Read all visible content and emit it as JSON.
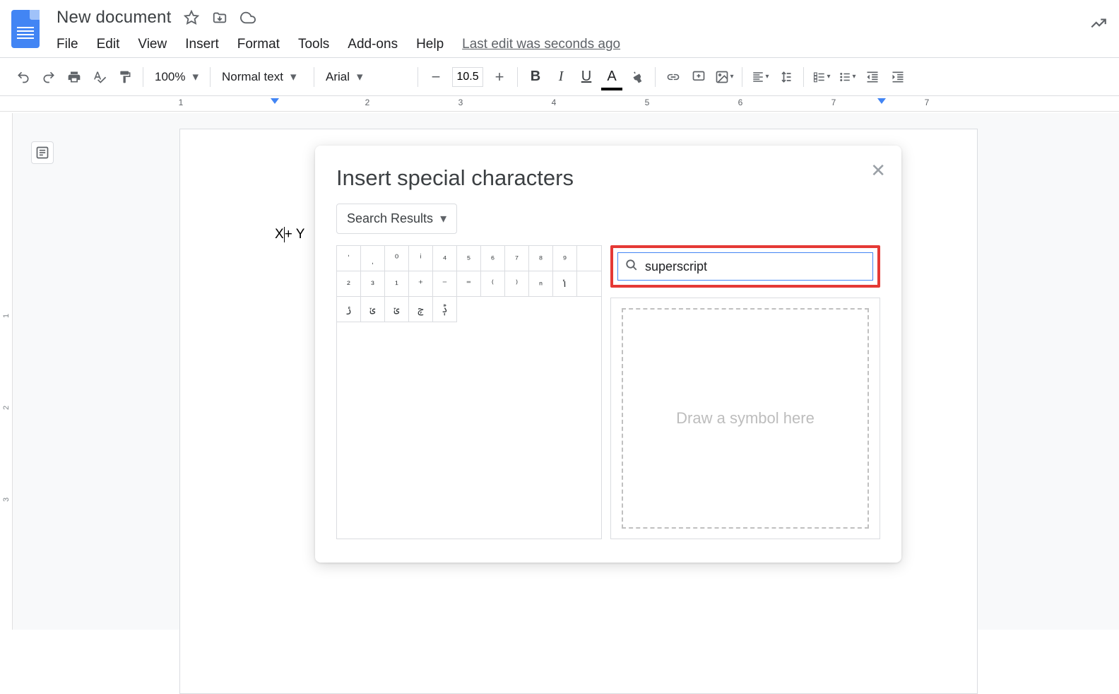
{
  "doc_title": "New document",
  "menu": [
    "File",
    "Edit",
    "View",
    "Insert",
    "Format",
    "Tools",
    "Add-ons",
    "Help"
  ],
  "last_edit": "Last edit was seconds ago",
  "toolbar": {
    "zoom": "100%",
    "style": "Normal text",
    "font": "Arial",
    "font_size": "10.5"
  },
  "ruler": {
    "nums": [
      "1",
      "2",
      "3",
      "4",
      "5",
      "6",
      "7"
    ]
  },
  "vruler": {
    "nums": [
      "1",
      "2",
      "3"
    ]
  },
  "doc_text_before": "X",
  "doc_text_after": "+ Y",
  "dialog": {
    "title": "Insert special characters",
    "category": "Search Results",
    "search_value": "superscript",
    "draw_placeholder": "Draw a symbol here",
    "chars_row1": [
      "ˈ",
      "ˌ",
      "⁰",
      "ⁱ",
      "⁴",
      "⁵",
      "⁶",
      "⁷",
      "⁸",
      "⁹"
    ],
    "chars_row2": [
      "²",
      "³",
      "¹",
      "⁺",
      "⁻",
      "⁼",
      "⁽",
      "⁾",
      "ⁿ",
      "ݳ"
    ],
    "chars_row3": [
      "ݬ",
      "ݵ",
      "ݶ",
      "ݼ",
      "ݙ"
    ]
  }
}
